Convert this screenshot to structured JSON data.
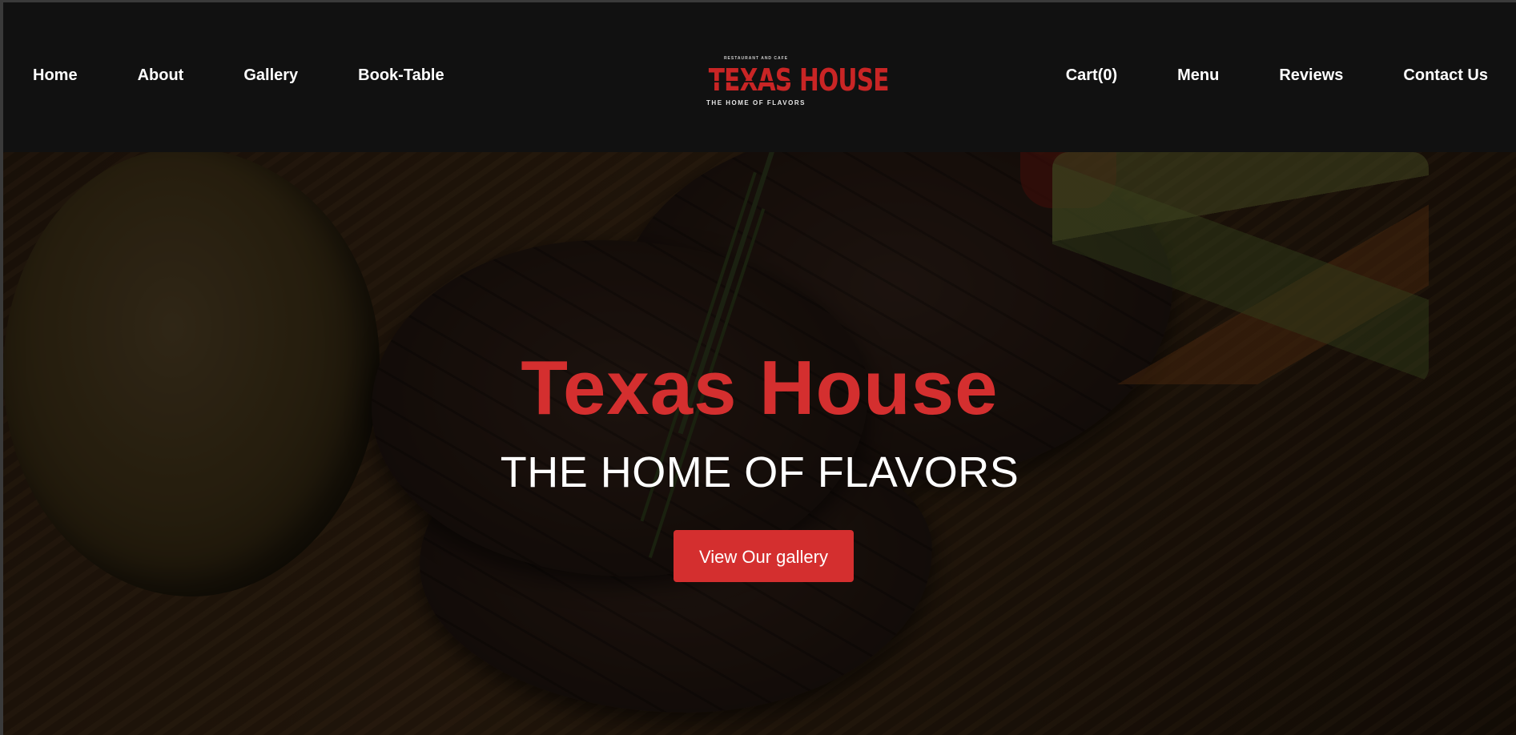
{
  "nav": {
    "left": [
      {
        "label": "Home"
      },
      {
        "label": "About"
      },
      {
        "label": "Gallery"
      },
      {
        "label": "Book-Table"
      }
    ],
    "right": [
      {
        "label": "Cart(0)"
      },
      {
        "label": "Menu"
      },
      {
        "label": "Reviews"
      },
      {
        "label": "Contact Us"
      }
    ]
  },
  "logo": {
    "top_text": "RESTAURANT AND CAFE",
    "main_text": "TEXAS HOUSE",
    "bottom_text": "THE HOME OF FLAVORS"
  },
  "hero": {
    "title": "Texas House",
    "subtitle": "THE HOME OF FLAVORS",
    "button_label": "View Our gallery"
  },
  "colors": {
    "accent": "#d42f2f",
    "nav_background": "#111111",
    "text": "#ffffff"
  }
}
